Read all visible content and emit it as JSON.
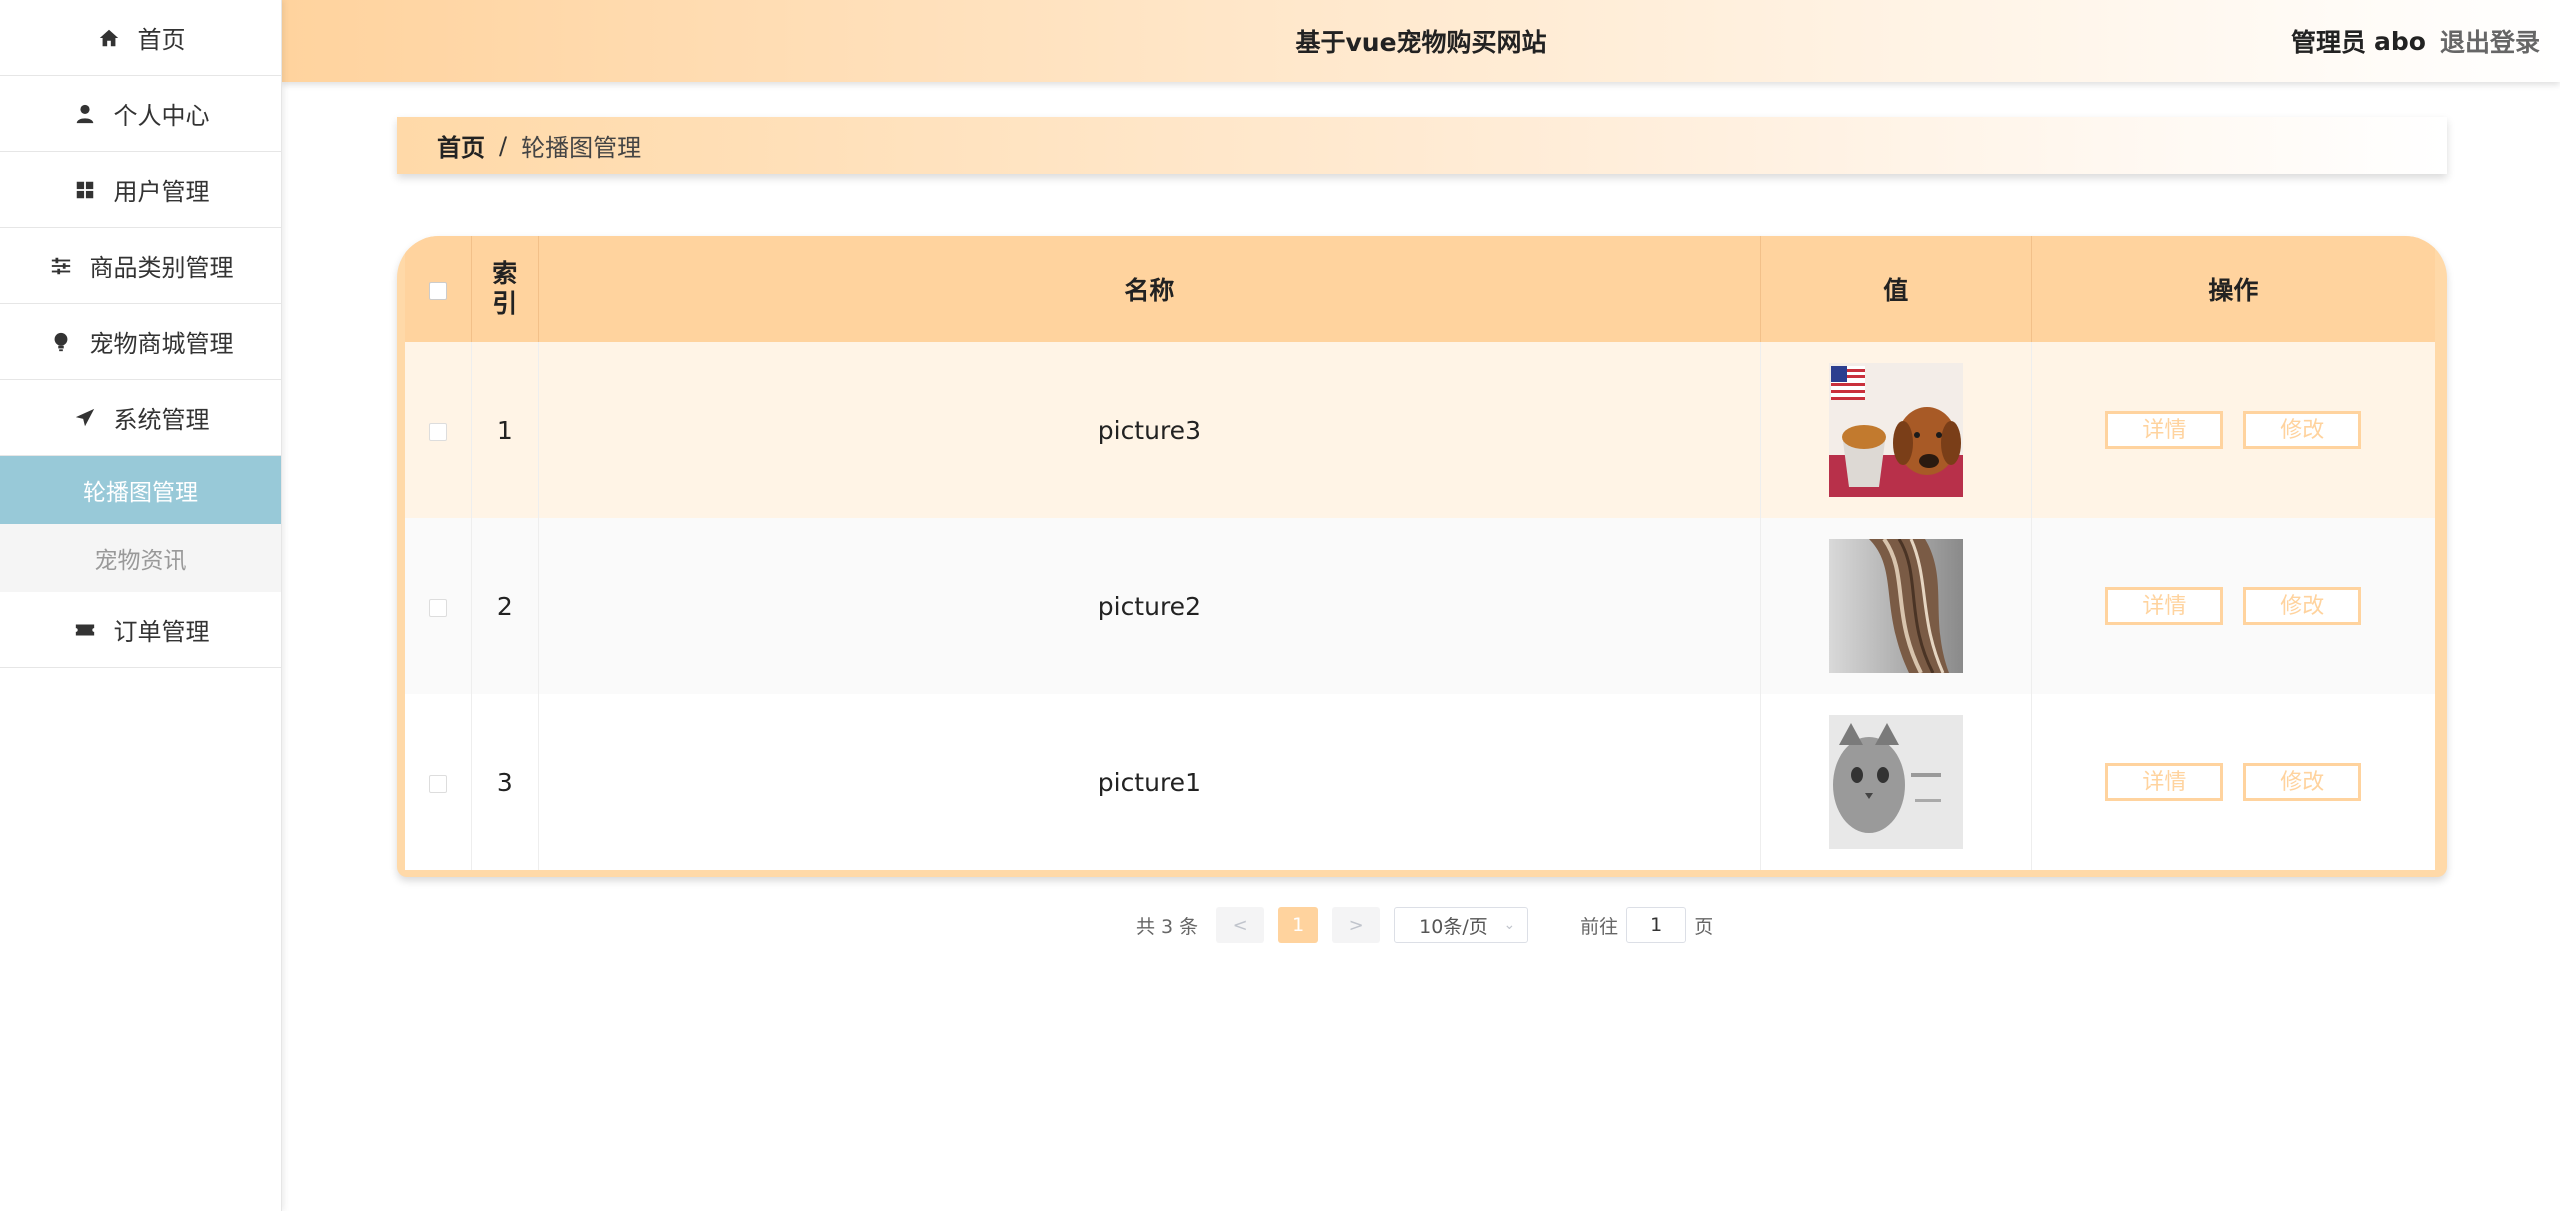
{
  "sidebar": {
    "items": [
      {
        "label": "首页",
        "icon": "home-icon"
      },
      {
        "label": "个人中心",
        "icon": "user-icon"
      },
      {
        "label": "用户管理",
        "icon": "grid-icon"
      },
      {
        "label": "商品类别管理",
        "icon": "sliders-icon"
      },
      {
        "label": "宠物商城管理",
        "icon": "bulb-icon"
      },
      {
        "label": "系统管理",
        "icon": "send-icon"
      }
    ],
    "sub_items": [
      {
        "label": "轮播图管理",
        "active": true
      },
      {
        "label": "宠物资讯",
        "active": false
      }
    ],
    "last_item": {
      "label": "订单管理",
      "icon": "ticket-icon"
    }
  },
  "header": {
    "title": "基于vue宠物购买网站",
    "role": "管理员",
    "username": "abo",
    "logout": "退出登录"
  },
  "breadcrumb": {
    "home": "首页",
    "separator": "/",
    "current": "轮播图管理"
  },
  "table": {
    "headers": {
      "index": "索引",
      "name": "名称",
      "value": "值",
      "actions": "操作"
    },
    "rows": [
      {
        "index": "1",
        "name": "picture3",
        "image": "petfood-dog-image"
      },
      {
        "index": "2",
        "name": "picture2",
        "image": "wood-closeup-image"
      },
      {
        "index": "3",
        "name": "picture1",
        "image": "gray-cat-image"
      }
    ],
    "detail_label": "详情",
    "edit_label": "修改"
  },
  "pagination": {
    "total": "共 3 条",
    "prev": "<",
    "current_page": "1",
    "next": ">",
    "page_size": "10条/页",
    "goto_label": "前往",
    "goto_value": "1",
    "page_suffix": "页"
  },
  "colors": {
    "accent": "#ffd39e",
    "active_menu": "#98c9d8"
  }
}
